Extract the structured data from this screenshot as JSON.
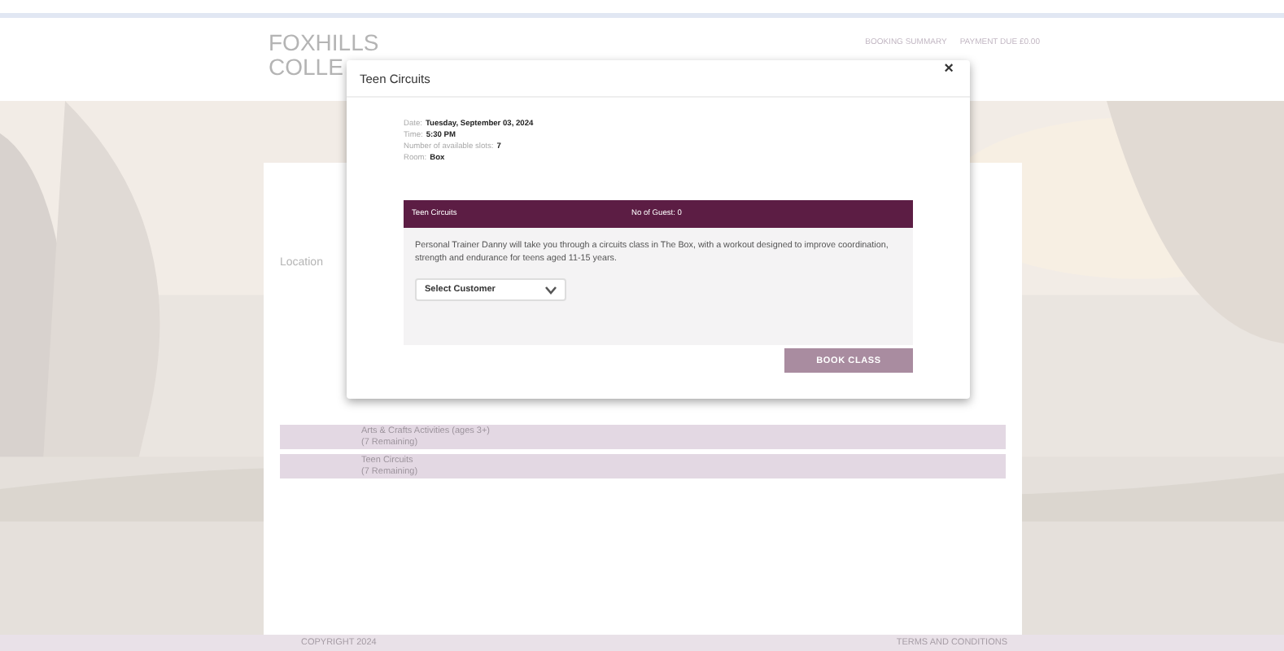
{
  "header": {
    "logo_top": "FOXHILLS",
    "logo_bottom": "COLLE",
    "nav": [
      "BOOKING SUMMARY",
      "PAYMENT DUE £0.00"
    ]
  },
  "page": {
    "location_label": "Location",
    "classes": [
      {
        "title": "Arts & Crafts Activities (ages 3+)",
        "remaining": "(7 Remaining)"
      },
      {
        "title": "Teen Circuits",
        "remaining": "(7 Remaining)"
      }
    ]
  },
  "footer": {
    "left": "COPYRIGHT 2024",
    "right": "TERMS AND CONDITIONS"
  },
  "modal": {
    "title": "Teen Circuits",
    "close": "×",
    "details": [
      {
        "label": "Date:",
        "value": "Tuesday, September 03, 2024"
      },
      {
        "label": "Time:",
        "value": "5:30 PM"
      },
      {
        "label": "Number of available slots:",
        "value": "7"
      },
      {
        "label": "Room:",
        "value": "Box"
      }
    ],
    "class_bar": {
      "name": "Teen Circuits",
      "guests": "No of Guest: 0"
    },
    "description": "Personal Trainer Danny will take you through a circuits class in The Box, with a workout designed to improve coordination, strength and endurance for teens aged 11-15 years.",
    "customer_select": {
      "value": "Select Customer"
    },
    "button": "BOOK CLASS"
  }
}
